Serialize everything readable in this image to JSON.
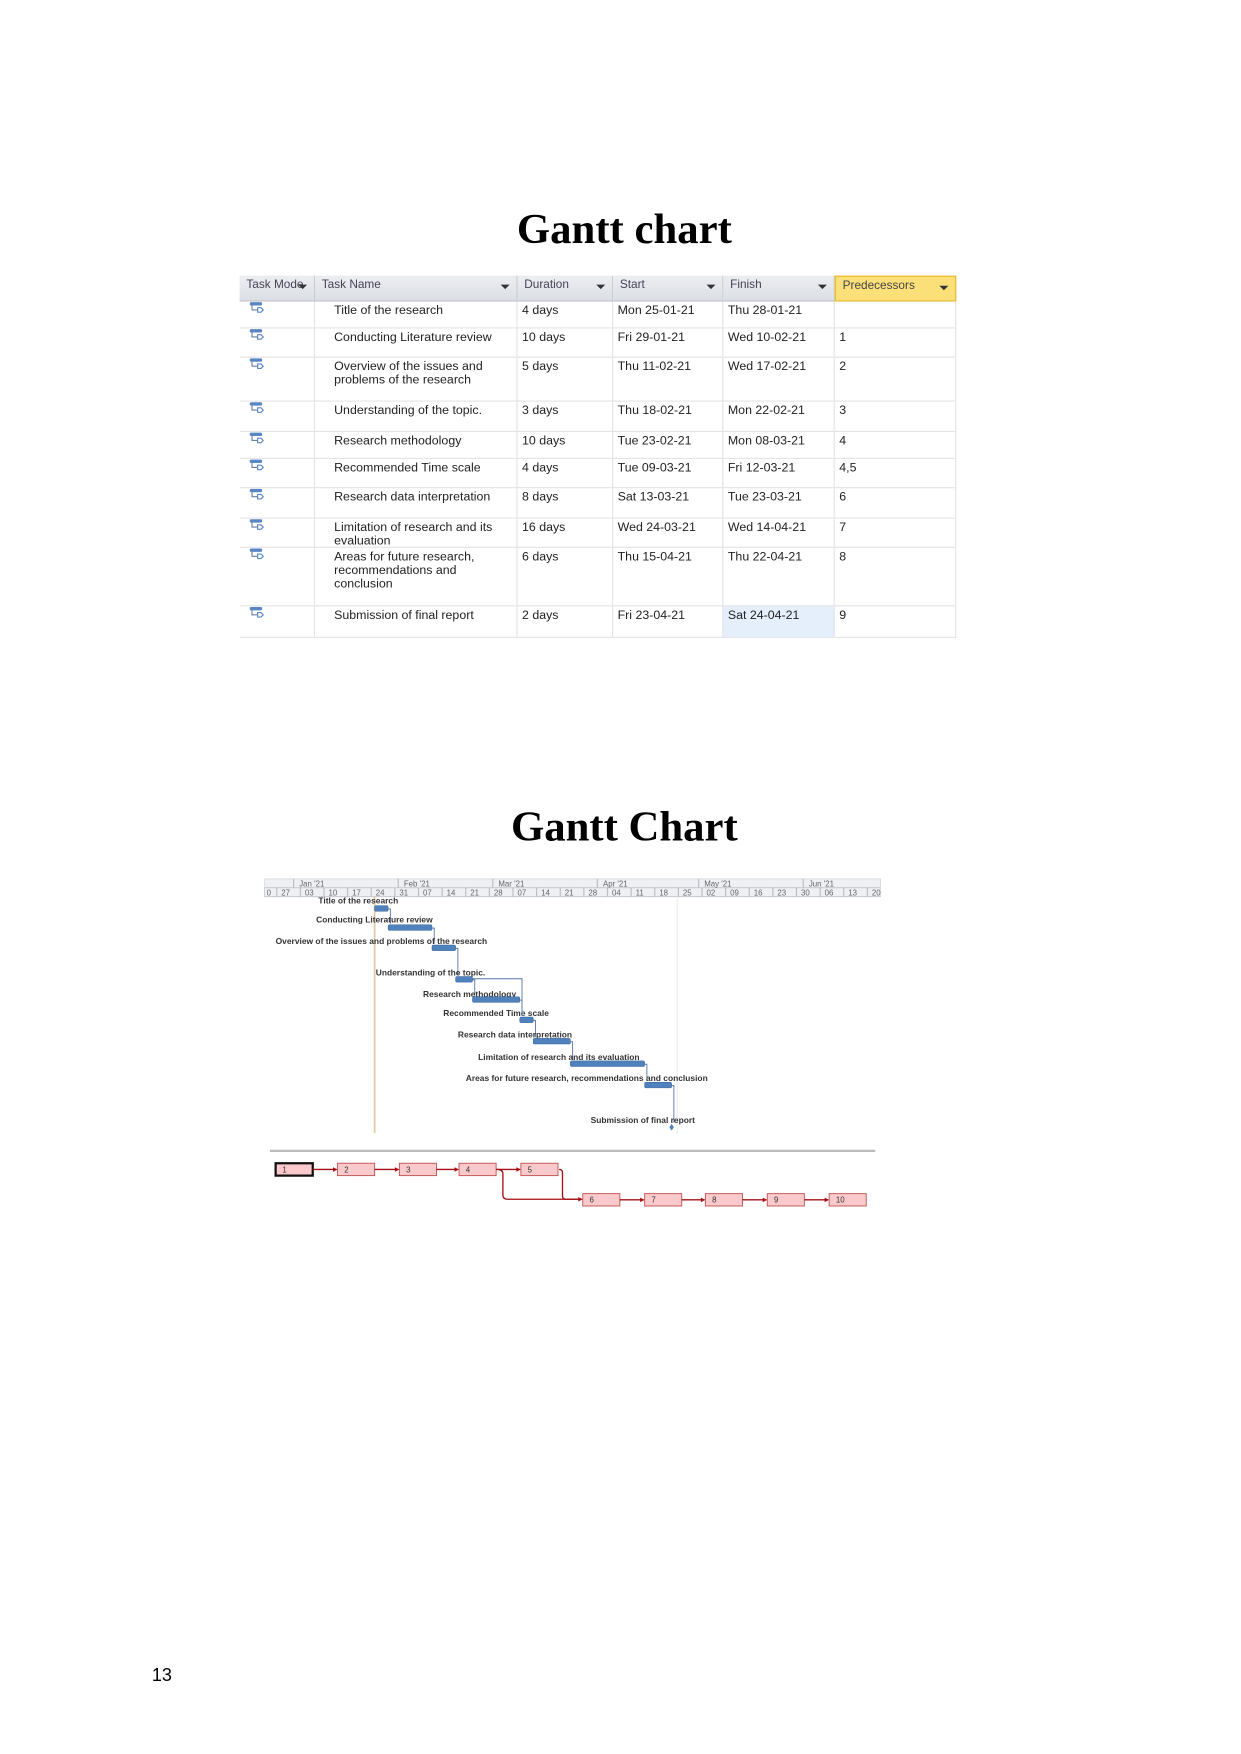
{
  "table_section": {
    "title": "Gantt chart",
    "columns": [
      "Task Mode",
      "Task Name",
      "Duration",
      "Start",
      "Finish",
      "Predecessors"
    ],
    "rows": [
      {
        "name": "Title of the research",
        "duration": "4 days",
        "start": "Mon 25-01-21",
        "finish": "Thu 28-01-21",
        "pred": ""
      },
      {
        "name": "Conducting Literature review",
        "duration": "10 days",
        "start": "Fri 29-01-21",
        "finish": "Wed 10-02-21",
        "pred": "1"
      },
      {
        "name": "Overview of the issues and problems of the research",
        "duration": "5 days",
        "start": "Thu 11-02-21",
        "finish": "Wed 17-02-21",
        "pred": "2"
      },
      {
        "name": "Understanding of the topic.",
        "duration": "3 days",
        "start": "Thu 18-02-21",
        "finish": "Mon 22-02-21",
        "pred": "3"
      },
      {
        "name": "Research methodology",
        "duration": "10 days",
        "start": "Tue 23-02-21",
        "finish": "Mon 08-03-21",
        "pred": "4"
      },
      {
        "name": "Recommended Time scale",
        "duration": "4 days",
        "start": "Tue 09-03-21",
        "finish": "Fri 12-03-21",
        "pred": "4,5"
      },
      {
        "name": "Research data interpretation",
        "duration": "8 days",
        "start": "Sat 13-03-21",
        "finish": "Tue 23-03-21",
        "pred": "6"
      },
      {
        "name": "Limitation of research and its evaluation",
        "duration": "16 days",
        "start": "Wed 24-03-21",
        "finish": "Wed 14-04-21",
        "pred": "7"
      },
      {
        "name": "Areas for future research, recommendations and conclusion",
        "duration": "6 days",
        "start": "Thu 15-04-21",
        "finish": "Thu 22-04-21",
        "pred": "8"
      },
      {
        "name": "Submission of final report",
        "duration": "2 days",
        "start": "Fri 23-04-21",
        "finish": "Sat 24-04-21",
        "pred": "9"
      }
    ]
  },
  "chart_section": {
    "title": "Gantt Chart",
    "months": [
      "Jan '21",
      "Feb '21",
      "Mar '21",
      "Apr '21",
      "May '21",
      "Jun '21"
    ],
    "week_ticks": [
      "0",
      "27",
      "03",
      "10",
      "17",
      "24",
      "31",
      "07",
      "14",
      "21",
      "28",
      "07",
      "14",
      "21",
      "28",
      "04",
      "11",
      "18",
      "25",
      "02",
      "09",
      "16",
      "23",
      "30",
      "06",
      "13",
      "20"
    ],
    "bar_labels": [
      "Title of the research",
      "Conducting Literature review",
      "Overview of the issues and problems of the research",
      "Understanding of the topic.",
      "Research methodology",
      "Recommended Time scale",
      "Research data interpretation",
      "Limitation of research and its evaluation",
      "Areas for future research, recommendations and conclusion",
      "Submission of final report"
    ],
    "network_nodes": [
      "1",
      "2",
      "3",
      "4",
      "5",
      "6",
      "7",
      "8",
      "9",
      "10"
    ],
    "colors": {
      "bar": "#4f81bd",
      "today_line": "#e3c9a6",
      "node_fill": "#f9c9cc",
      "node_border": "#c0504d",
      "link": "#a50f15",
      "header_accent": "#fbe07a"
    }
  },
  "chart_data": {
    "type": "gantt",
    "tasks": [
      {
        "id": 1,
        "name": "Title of the research",
        "start": "2021-01-25",
        "finish": "2021-01-28",
        "predecessors": []
      },
      {
        "id": 2,
        "name": "Conducting Literature review",
        "start": "2021-01-29",
        "finish": "2021-02-10",
        "predecessors": [
          1
        ]
      },
      {
        "id": 3,
        "name": "Overview of the issues and problems of the research",
        "start": "2021-02-11",
        "finish": "2021-02-17",
        "predecessors": [
          2
        ]
      },
      {
        "id": 4,
        "name": "Understanding of the topic.",
        "start": "2021-02-18",
        "finish": "2021-02-22",
        "predecessors": [
          3
        ]
      },
      {
        "id": 5,
        "name": "Research methodology",
        "start": "2021-02-23",
        "finish": "2021-03-08",
        "predecessors": [
          4
        ]
      },
      {
        "id": 6,
        "name": "Recommended Time scale",
        "start": "2021-03-09",
        "finish": "2021-03-12",
        "predecessors": [
          4,
          5
        ]
      },
      {
        "id": 7,
        "name": "Research data interpretation",
        "start": "2021-03-13",
        "finish": "2021-03-23",
        "predecessors": [
          6
        ]
      },
      {
        "id": 8,
        "name": "Limitation of research and its evaluation",
        "start": "2021-03-24",
        "finish": "2021-04-14",
        "predecessors": [
          7
        ]
      },
      {
        "id": 9,
        "name": "Areas for future research, recommendations and conclusion",
        "start": "2021-04-15",
        "finish": "2021-04-22",
        "predecessors": [
          8
        ]
      },
      {
        "id": 10,
        "name": "Submission of final report",
        "start": "2021-04-23",
        "finish": "2021-04-24",
        "predecessors": [
          9
        ]
      }
    ],
    "x_range": [
      "2020-12-20",
      "2021-06-20"
    ]
  },
  "page_number": "13"
}
